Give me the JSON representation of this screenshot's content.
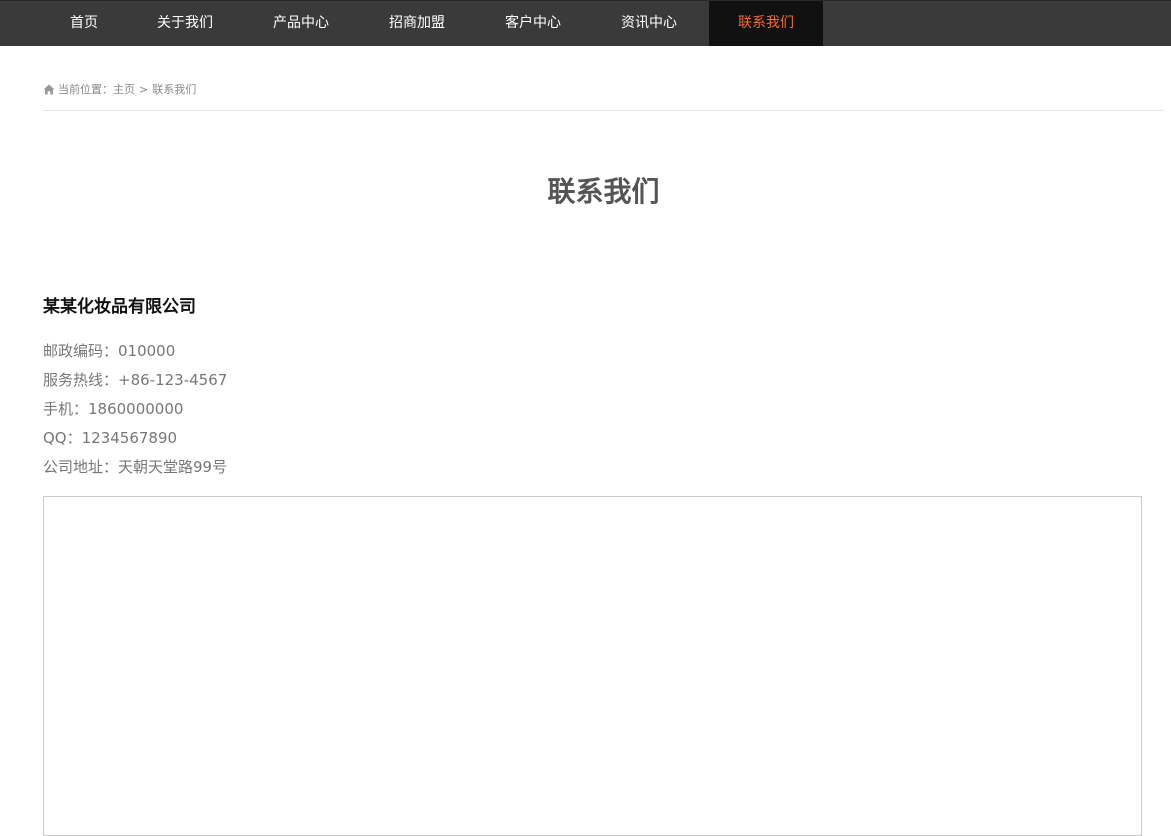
{
  "nav": {
    "items": [
      {
        "label": "首页"
      },
      {
        "label": "关于我们"
      },
      {
        "label": "产品中心"
      },
      {
        "label": "招商加盟"
      },
      {
        "label": "客户中心"
      },
      {
        "label": "资讯中心"
      },
      {
        "label": "联系我们",
        "active": true
      }
    ],
    "active_color": "#f26c2a",
    "bar_color": "#3a3a3a"
  },
  "breadcrumb": {
    "icon": "home-icon",
    "prefix": "当前位置：",
    "home": "主页",
    "separator": ">",
    "current": "联系我们"
  },
  "page": {
    "title": "联系我们"
  },
  "contact": {
    "company": "某某化妆品有限公司",
    "lines": [
      "邮政编码：010000",
      "服务热线：+86-123-4567",
      "手机：1860000000",
      "QQ：1234567890",
      "公司地址：天朝天堂路99号"
    ]
  }
}
